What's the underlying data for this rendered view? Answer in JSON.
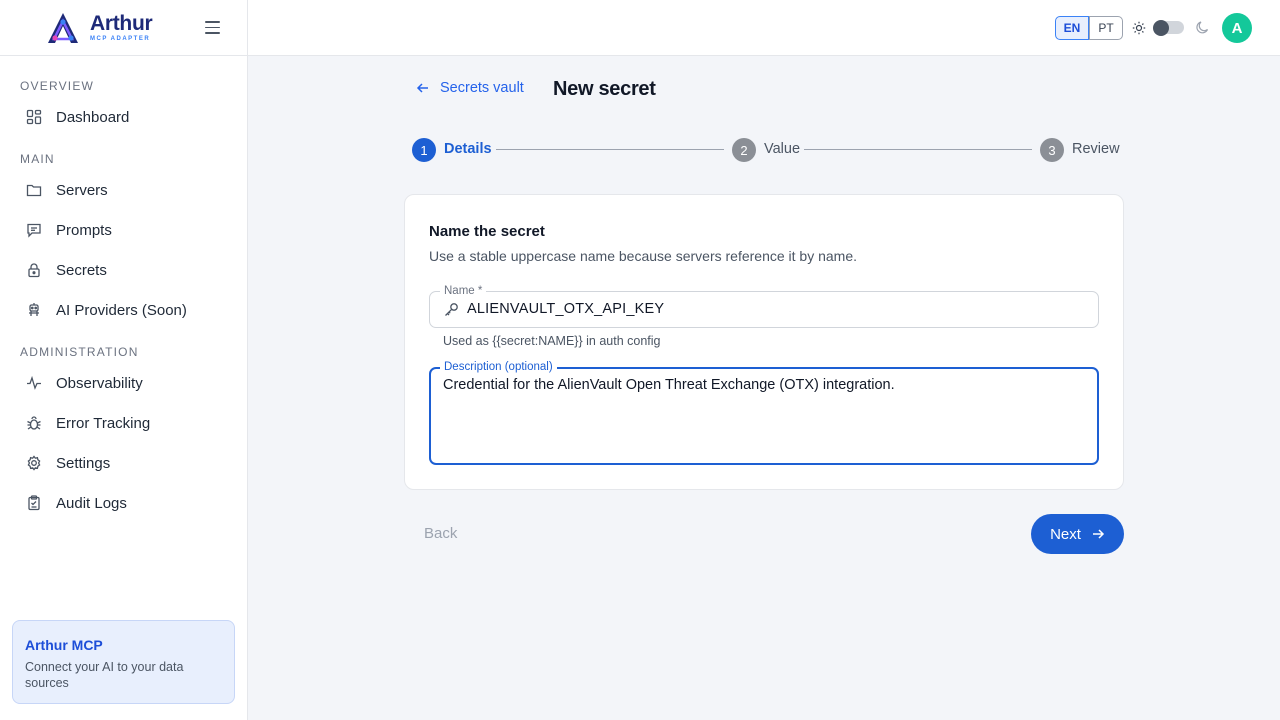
{
  "brand": {
    "name": "Arthur",
    "sub": "MCP ADAPTER"
  },
  "sidebar": {
    "sections": [
      {
        "label": "OVERVIEW"
      },
      {
        "label": "MAIN"
      },
      {
        "label": "ADMINISTRATION"
      }
    ],
    "items": [
      {
        "label": "Dashboard",
        "icon": "dashboard-icon"
      },
      {
        "label": "Servers",
        "icon": "folder-icon"
      },
      {
        "label": "Prompts",
        "icon": "message-icon"
      },
      {
        "label": "Secrets",
        "icon": "lock-icon"
      },
      {
        "label": "AI Providers (Soon)",
        "icon": "robot-icon"
      },
      {
        "label": "Observability",
        "icon": "activity-icon"
      },
      {
        "label": "Error Tracking",
        "icon": "bug-icon"
      },
      {
        "label": "Settings",
        "icon": "gear-icon"
      },
      {
        "label": "Audit Logs",
        "icon": "clipboard-icon"
      }
    ],
    "promo": {
      "title": "Arthur MCP",
      "text": "Connect your AI to your data sources"
    }
  },
  "topbar": {
    "lang_en": "EN",
    "lang_pt": "PT",
    "avatar_initial": "A",
    "colors": {
      "avatar": "#14c89a",
      "accent": "#1d5fd3"
    }
  },
  "main": {
    "back_link": "Secrets vault",
    "title": "New secret",
    "steps": [
      {
        "num": "1",
        "label": "Details",
        "state": "active"
      },
      {
        "num": "2",
        "label": "Value",
        "state": "inactive"
      },
      {
        "num": "3",
        "label": "Review",
        "state": "inactive"
      }
    ],
    "card": {
      "title": "Name the secret",
      "subtitle": "Use a stable uppercase name because servers reference it by name.",
      "name_label": "Name *",
      "name_value": "ALIENVAULT_OTX_API_KEY",
      "name_helper": "Used as {{secret:NAME}} in auth config",
      "desc_label": "Description (optional)",
      "desc_value": "Credential for the AlienVault Open Threat Exchange (OTX) integration."
    },
    "back_button": "Back",
    "next_button": "Next"
  }
}
